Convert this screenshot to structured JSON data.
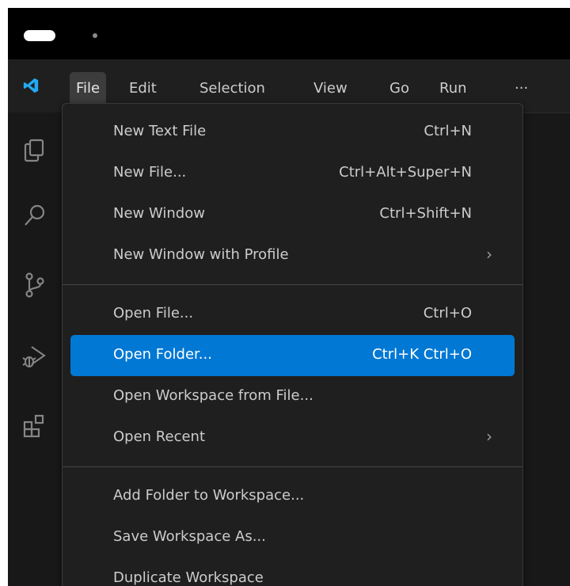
{
  "window": {
    "menubar": [
      "File",
      "Edit",
      "Selection",
      "View",
      "Go",
      "Run",
      "···"
    ],
    "active_menu": "File"
  },
  "activity_icons": [
    "explorer-icon",
    "search-icon",
    "source-control-icon",
    "run-debug-icon",
    "extensions-icon"
  ],
  "file_menu": {
    "group1": [
      {
        "label": "New Text File",
        "shortcut": "Ctrl+N"
      },
      {
        "label": "New File...",
        "shortcut": "Ctrl+Alt+Super+N"
      },
      {
        "label": "New Window",
        "shortcut": "Ctrl+Shift+N"
      },
      {
        "label": "New Window with Profile",
        "shortcut": "",
        "submenu": true
      }
    ],
    "group2": [
      {
        "label": "Open File...",
        "shortcut": "Ctrl+O"
      },
      {
        "label": "Open Folder...",
        "shortcut": "Ctrl+K Ctrl+O",
        "highlighted": true
      },
      {
        "label": "Open Workspace from File...",
        "shortcut": ""
      },
      {
        "label": "Open Recent",
        "shortcut": "",
        "submenu": true
      }
    ],
    "group3": [
      {
        "label": "Add Folder to Workspace...",
        "shortcut": ""
      },
      {
        "label": "Save Workspace As...",
        "shortcut": ""
      },
      {
        "label": "Duplicate Workspace",
        "shortcut": ""
      }
    ]
  },
  "colors": {
    "highlight": "#0078d4",
    "logo": "#23a9f2",
    "background": "#181818"
  }
}
